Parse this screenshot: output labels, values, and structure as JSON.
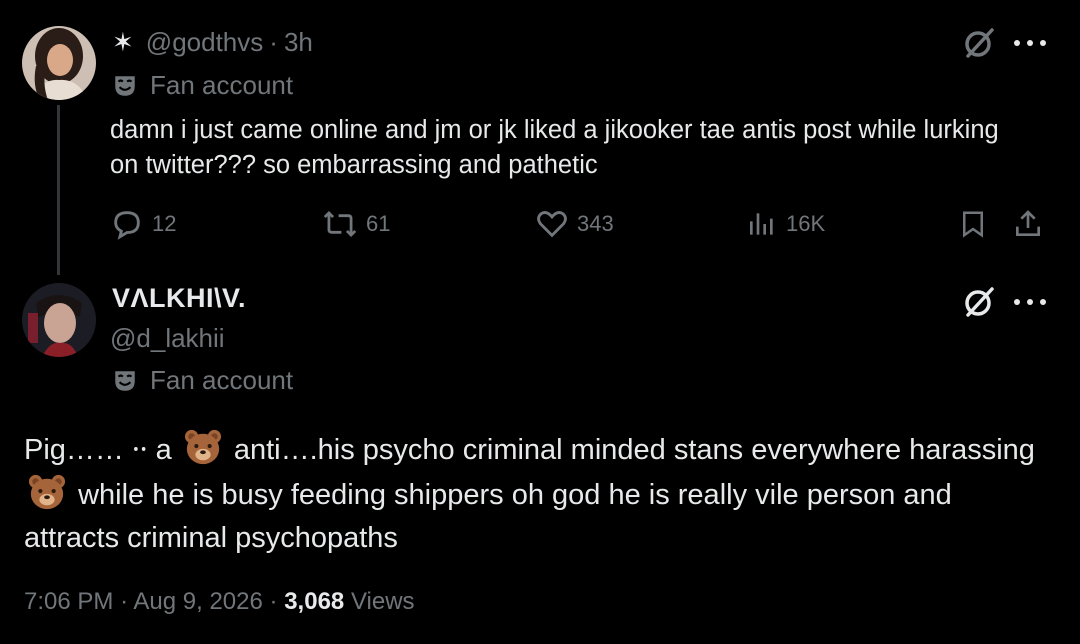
{
  "parent_post": {
    "badge_glyph": "✶",
    "handle": "@godthvs",
    "separator": "·",
    "time_ago": "3h",
    "label": "Fan account",
    "text": "damn i just came online and jm or jk liked a jikooker tae antis post while lurking on twitter??? so embarrassing and pathetic",
    "replies": "12",
    "reposts": "61",
    "likes": "343",
    "views": "16K"
  },
  "main_post": {
    "display_name": "VΛLKHI\\V.",
    "handle": "@d_lakhii",
    "label": "Fan account",
    "text_part1": "Pig…… ⸱⸱ a",
    "text_part2": "anti….his psycho criminal minded stans everywhere harassing",
    "text_part3": "while he is busy feeding shippers oh god he is really vile person and attracts criminal psychopaths",
    "emoji_name": "bear-face",
    "time": "7:06 PM",
    "dot1": "·",
    "date": "Aug 9, 2026",
    "dot2": "·",
    "views_count": "3,068",
    "views_label": "Views"
  },
  "icons": {
    "grok": "grok-slash-icon",
    "more": "more-options-icon",
    "mask": "theater-mask-icon",
    "reply": "reply-icon",
    "repost": "repost-icon",
    "like": "heart-icon",
    "views": "analytics-icon",
    "bookmark": "bookmark-icon",
    "share": "share-icon"
  },
  "colors": {
    "background": "#000000",
    "text": "#e7e9ea",
    "muted": "#71767b",
    "thread_line": "#333639"
  }
}
